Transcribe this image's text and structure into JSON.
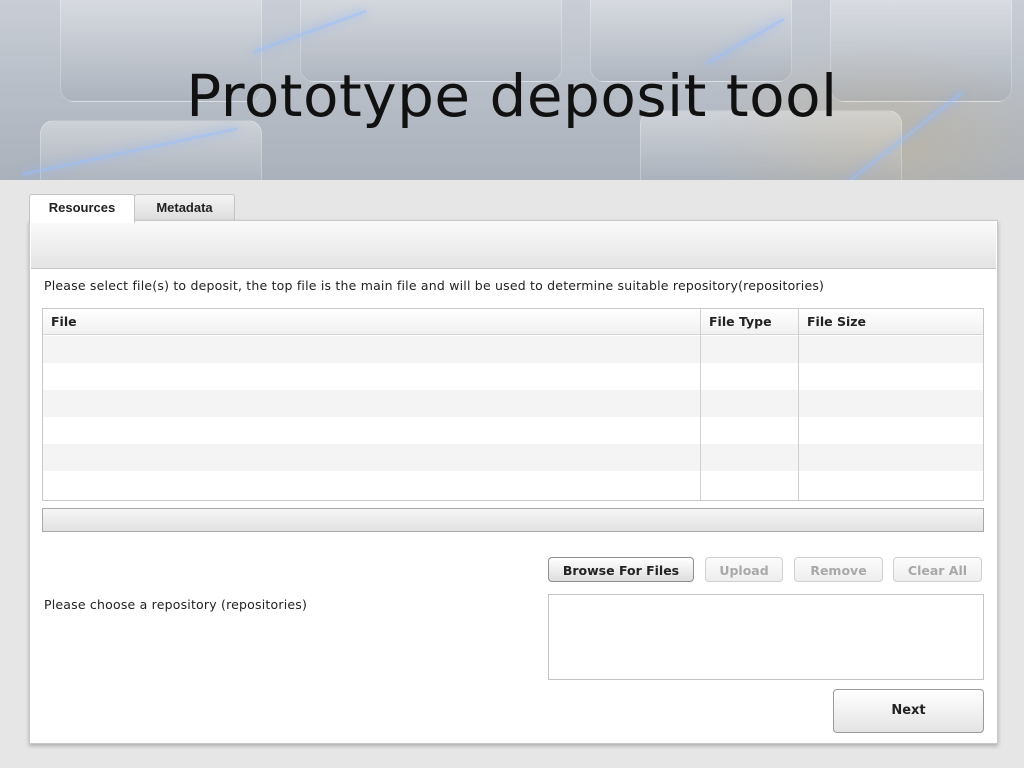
{
  "slide": {
    "title": "Prototype deposit tool"
  },
  "tabs": [
    {
      "label": "Resources",
      "selected": true
    },
    {
      "label": "Metadata",
      "selected": false
    }
  ],
  "instruction_text": "Please select file(s) to deposit, the top file is the main file and will be used to determine suitable repository(repositories)",
  "file_table": {
    "columns": [
      "File",
      "File Type",
      "File Size"
    ],
    "rows": []
  },
  "buttons": {
    "browse": {
      "label": "Browse For Files",
      "enabled": true
    },
    "upload": {
      "label": "Upload",
      "enabled": false
    },
    "remove": {
      "label": "Remove",
      "enabled": false
    },
    "clear_all": {
      "label": "Clear All",
      "enabled": false
    },
    "next": {
      "label": "Next",
      "enabled": true
    }
  },
  "repository": {
    "label": "Please choose a repository (repositories)",
    "options": []
  },
  "colors": {
    "panel_bg": "#ffffff",
    "page_bg": "#e6e6e6",
    "row_stripe": "#f4f4f4",
    "disabled_text": "#a8a8a8"
  }
}
